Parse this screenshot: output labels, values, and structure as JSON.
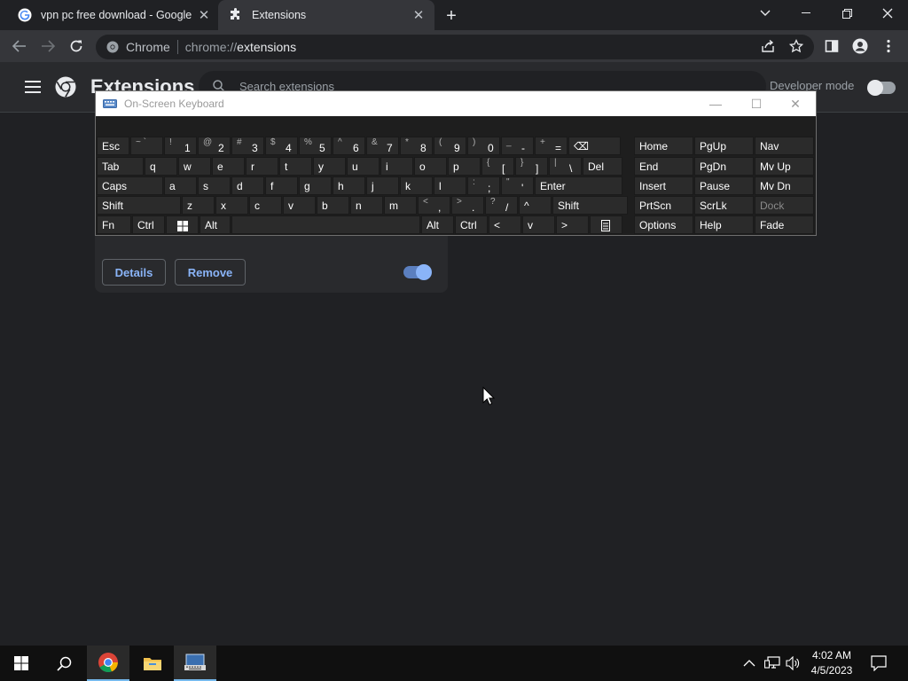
{
  "browser": {
    "tabs": [
      {
        "title": "vpn pc free download - Google S",
        "favicon": "google-g-icon"
      },
      {
        "title": "Extensions",
        "favicon": "puzzle-piece-icon",
        "active": true
      }
    ],
    "omnibox": {
      "chip": "Chrome",
      "scheme": "chrome://",
      "path": "extensions"
    }
  },
  "extensions_page": {
    "title": "Extensions",
    "search_placeholder": "Search extensions",
    "developer_mode_label": "Developer mode",
    "developer_mode_on": false,
    "card": {
      "details_label": "Details",
      "remove_label": "Remove",
      "enabled": true
    }
  },
  "osk": {
    "title": "On-Screen Keyboard",
    "rows": [
      [
        {
          "id": "esc",
          "label": "Esc"
        },
        {
          "id": "tilde",
          "sub": "~ `",
          "main": ""
        },
        {
          "id": "1",
          "sub": "!",
          "main": "1"
        },
        {
          "id": "2",
          "sub": "@",
          "main": "2"
        },
        {
          "id": "3",
          "sub": "#",
          "main": "3"
        },
        {
          "id": "4",
          "sub": "$",
          "main": "4"
        },
        {
          "id": "5",
          "sub": "%",
          "main": "5"
        },
        {
          "id": "6",
          "sub": "^",
          "main": "6"
        },
        {
          "id": "7",
          "sub": "&",
          "main": "7"
        },
        {
          "id": "8",
          "sub": "*",
          "main": "8"
        },
        {
          "id": "9",
          "sub": "(",
          "main": "9"
        },
        {
          "id": "0",
          "sub": ")",
          "main": "0"
        },
        {
          "id": "minus",
          "sub": "_",
          "main": "-"
        },
        {
          "id": "equals",
          "sub": "+",
          "main": "="
        },
        {
          "id": "backspace",
          "label": "⌫"
        }
      ],
      [
        {
          "id": "tab",
          "label": "Tab"
        },
        {
          "id": "q",
          "label": "q"
        },
        {
          "id": "w",
          "label": "w"
        },
        {
          "id": "e",
          "label": "e"
        },
        {
          "id": "r",
          "label": "r"
        },
        {
          "id": "t",
          "label": "t"
        },
        {
          "id": "y",
          "label": "y"
        },
        {
          "id": "u",
          "label": "u"
        },
        {
          "id": "i",
          "label": "i"
        },
        {
          "id": "o",
          "label": "o"
        },
        {
          "id": "p",
          "label": "p"
        },
        {
          "id": "lbracket",
          "sub": "{",
          "main": "["
        },
        {
          "id": "rbracket",
          "sub": "}",
          "main": "]"
        },
        {
          "id": "backslash",
          "sub": "|",
          "main": "\\"
        },
        {
          "id": "del",
          "label": "Del"
        }
      ],
      [
        {
          "id": "caps",
          "label": "Caps"
        },
        {
          "id": "a",
          "label": "a"
        },
        {
          "id": "s",
          "label": "s"
        },
        {
          "id": "d",
          "label": "d"
        },
        {
          "id": "f",
          "label": "f"
        },
        {
          "id": "g",
          "label": "g"
        },
        {
          "id": "h",
          "label": "h"
        },
        {
          "id": "j",
          "label": "j"
        },
        {
          "id": "k",
          "label": "k"
        },
        {
          "id": "l",
          "label": "l"
        },
        {
          "id": "semicolon",
          "sub": ":",
          "main": ";"
        },
        {
          "id": "quote",
          "sub": "\"",
          "main": "'"
        },
        {
          "id": "enter",
          "label": "Enter"
        }
      ],
      [
        {
          "id": "lshift",
          "label": "Shift"
        },
        {
          "id": "z",
          "label": "z"
        },
        {
          "id": "x",
          "label": "x"
        },
        {
          "id": "c",
          "label": "c"
        },
        {
          "id": "v",
          "label": "v"
        },
        {
          "id": "b",
          "label": "b"
        },
        {
          "id": "n",
          "label": "n"
        },
        {
          "id": "m",
          "label": "m"
        },
        {
          "id": "comma",
          "sub": "<",
          "main": ","
        },
        {
          "id": "period",
          "sub": ">",
          "main": "."
        },
        {
          "id": "slash",
          "sub": "?",
          "main": "/"
        },
        {
          "id": "up",
          "label": "^"
        },
        {
          "id": "rshift",
          "label": "Shift"
        }
      ],
      [
        {
          "id": "fn",
          "label": "Fn"
        },
        {
          "id": "lctrl",
          "label": "Ctrl"
        },
        {
          "id": "win",
          "label": "win-logo-icon"
        },
        {
          "id": "lalt",
          "label": "Alt"
        },
        {
          "id": "space",
          "label": ""
        },
        {
          "id": "ralt",
          "label": "Alt"
        },
        {
          "id": "rctrl",
          "label": "Ctrl"
        },
        {
          "id": "left",
          "label": "<"
        },
        {
          "id": "down",
          "label": "v"
        },
        {
          "id": "right",
          "label": ">"
        },
        {
          "id": "menu",
          "label": "context-menu-icon"
        }
      ]
    ],
    "nav_rows": [
      [
        "Home",
        "PgUp",
        "Nav"
      ],
      [
        "End",
        "PgDn",
        "Mv Up"
      ],
      [
        "Insert",
        "Pause",
        "Mv Dn"
      ],
      [
        "PrtScn",
        "ScrLk",
        "Dock"
      ],
      [
        "Options",
        "Help",
        "Fade"
      ]
    ]
  },
  "taskbar": {
    "time": "4:02 AM",
    "date": "4/5/2023",
    "items": [
      "start-icon",
      "search-icon",
      "chrome-icon",
      "file-explorer-icon",
      "on-screen-keyboard-icon"
    ]
  }
}
